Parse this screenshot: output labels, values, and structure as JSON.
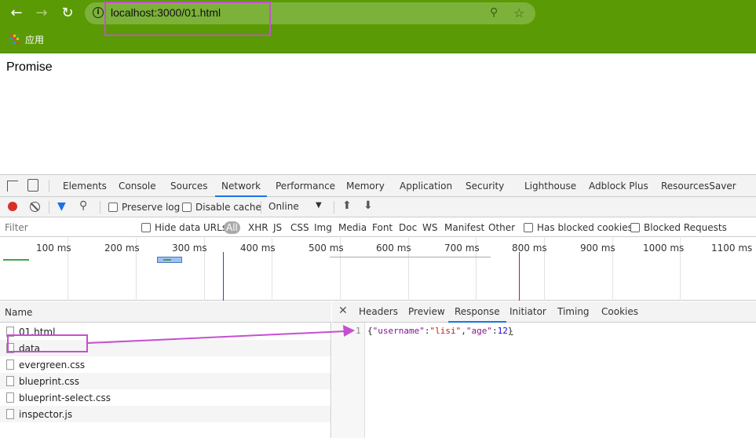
{
  "browser": {
    "url": "localhost:3000/01.html",
    "apps_label": "应用",
    "apps_colors": [
      "#e94235",
      "#fbbc04",
      "#34a853",
      "#4285f4",
      "#e94235",
      "#fbbc04",
      "#34a853",
      "#4285f4",
      "#e94235"
    ]
  },
  "page": {
    "title": "Promise"
  },
  "devtools": {
    "tabs": [
      "Elements",
      "Console",
      "Sources",
      "Network",
      "Performance",
      "Memory",
      "Application",
      "Security",
      "Lighthouse",
      "Adblock Plus",
      "ResourcesSaver"
    ],
    "active_tab": "Network",
    "toolbar": {
      "preserve_log": "Preserve log",
      "disable_cache": "Disable cache",
      "throttle": "Online"
    },
    "filter": {
      "placeholder": "Filter",
      "hide_data_urls": "Hide data URLs",
      "types": [
        "All",
        "XHR",
        "JS",
        "CSS",
        "Img",
        "Media",
        "Font",
        "Doc",
        "WS",
        "Manifest",
        "Other"
      ],
      "has_blocked_cookies": "Has blocked cookies",
      "blocked_requests": "Blocked Requests"
    },
    "timeline_ticks": [
      "100 ms",
      "200 ms",
      "300 ms",
      "400 ms",
      "500 ms",
      "600 ms",
      "700 ms",
      "800 ms",
      "900 ms",
      "1000 ms",
      "1100 ms"
    ],
    "requests": {
      "header": "Name",
      "rows": [
        "01.html",
        "data",
        "evergreen.css",
        "blueprint.css",
        "blueprint-select.css",
        "inspector.js"
      ]
    },
    "detail": {
      "tabs": [
        "Headers",
        "Preview",
        "Response",
        "Initiator",
        "Timing",
        "Cookies"
      ],
      "active_tab": "Response",
      "line_number": "1",
      "response": {
        "open": "{",
        "key1": "\"username\"",
        "colon1": ":",
        "val1": "\"lisi\"",
        "comma": ",",
        "key2": "\"age\"",
        "colon2": ":",
        "val2": "12",
        "close": "}"
      }
    }
  },
  "colors": {
    "chrome_bg": "#5a9a04",
    "annotation": "#c64fd1",
    "accent": "#1a73e8"
  }
}
